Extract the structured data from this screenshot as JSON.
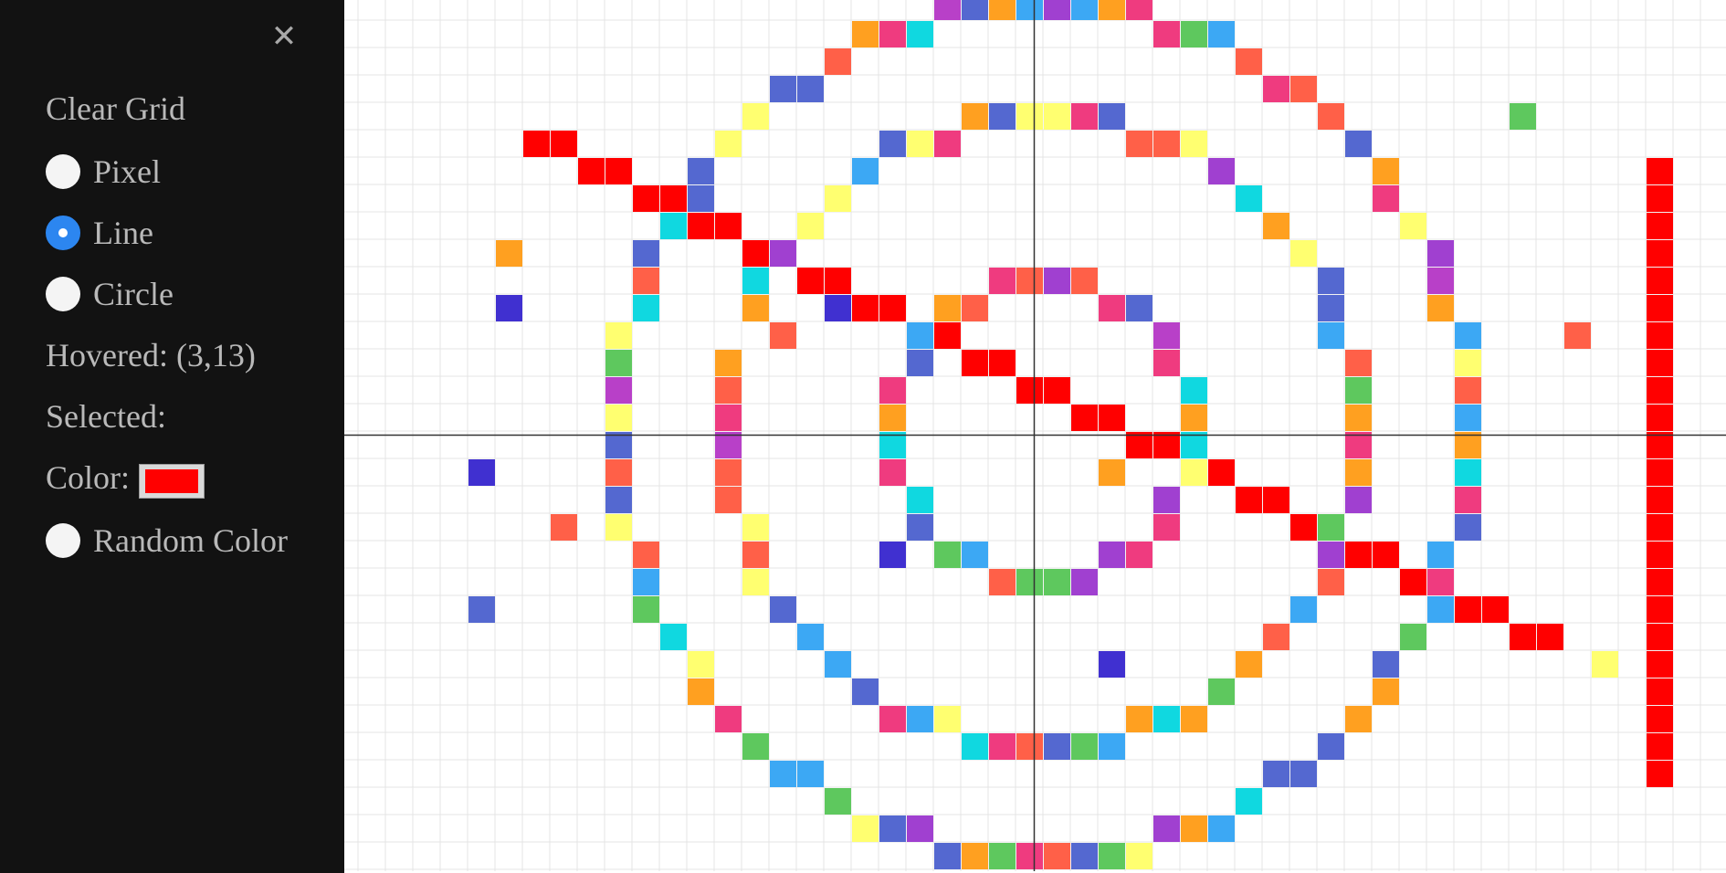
{
  "sidebar": {
    "clear_label": "Clear Grid",
    "modes": [
      {
        "label": "Pixel",
        "checked": false
      },
      {
        "label": "Line",
        "checked": true
      },
      {
        "label": "Circle",
        "checked": false
      }
    ],
    "hovered_text": "Hovered: (3,13)",
    "selected_text": "Selected:",
    "color_label": "Color:",
    "color_value": "#ff0000",
    "random_label": "Random Color",
    "close_icon": "close-icon"
  },
  "grid": {
    "colors": {
      "R": "#ff0000",
      "P": "#ef3b7f",
      "O": "#ff6048",
      "A": "#ffa020",
      "Y": "#ffff70",
      "G": "#5ec85e",
      "C": "#10d8e0",
      "S": "#3ca8f4",
      "B": "#5468d0",
      "V": "#a040d0",
      "I": "#4030d0",
      "M": "#b840c8"
    },
    "cells": [
      {
        "c": "M",
        "x": 21,
        "y": 0
      },
      {
        "c": "B",
        "x": 22,
        "y": 0
      },
      {
        "c": "A",
        "x": 23,
        "y": 0
      },
      {
        "c": "S",
        "x": 24,
        "y": 0
      },
      {
        "c": "V",
        "x": 25,
        "y": 0
      },
      {
        "c": "S",
        "x": 26,
        "y": 0
      },
      {
        "c": "A",
        "x": 27,
        "y": 0
      },
      {
        "c": "P",
        "x": 28,
        "y": 0
      },
      {
        "c": "A",
        "x": 18,
        "y": 1
      },
      {
        "c": "P",
        "x": 19,
        "y": 1
      },
      {
        "c": "C",
        "x": 20,
        "y": 1
      },
      {
        "c": "P",
        "x": 29,
        "y": 1
      },
      {
        "c": "G",
        "x": 30,
        "y": 1
      },
      {
        "c": "S",
        "x": 31,
        "y": 1
      },
      {
        "c": "O",
        "x": 17,
        "y": 2
      },
      {
        "c": "O",
        "x": 32,
        "y": 2
      },
      {
        "c": "B",
        "x": 15,
        "y": 3
      },
      {
        "c": "B",
        "x": 16,
        "y": 3
      },
      {
        "c": "P",
        "x": 33,
        "y": 3
      },
      {
        "c": "O",
        "x": 34,
        "y": 3
      },
      {
        "c": "Y",
        "x": 14,
        "y": 4
      },
      {
        "c": "A",
        "x": 22,
        "y": 4
      },
      {
        "c": "B",
        "x": 23,
        "y": 4
      },
      {
        "c": "Y",
        "x": 24,
        "y": 4
      },
      {
        "c": "Y",
        "x": 25,
        "y": 4
      },
      {
        "c": "P",
        "x": 26,
        "y": 4
      },
      {
        "c": "B",
        "x": 27,
        "y": 4
      },
      {
        "c": "O",
        "x": 35,
        "y": 4
      },
      {
        "c": "G",
        "x": 42,
        "y": 4
      },
      {
        "c": "R",
        "x": 6,
        "y": 5
      },
      {
        "c": "R",
        "x": 7,
        "y": 5
      },
      {
        "c": "Y",
        "x": 13,
        "y": 5
      },
      {
        "c": "B",
        "x": 19,
        "y": 5
      },
      {
        "c": "Y",
        "x": 20,
        "y": 5
      },
      {
        "c": "P",
        "x": 21,
        "y": 5
      },
      {
        "c": "O",
        "x": 28,
        "y": 5
      },
      {
        "c": "O",
        "x": 29,
        "y": 5
      },
      {
        "c": "Y",
        "x": 30,
        "y": 5
      },
      {
        "c": "B",
        "x": 36,
        "y": 5
      },
      {
        "c": "R",
        "x": 8,
        "y": 6
      },
      {
        "c": "R",
        "x": 9,
        "y": 6
      },
      {
        "c": "B",
        "x": 12,
        "y": 6
      },
      {
        "c": "S",
        "x": 18,
        "y": 6
      },
      {
        "c": "V",
        "x": 31,
        "y": 6
      },
      {
        "c": "A",
        "x": 37,
        "y": 6
      },
      {
        "c": "R",
        "x": 47,
        "y": 6
      },
      {
        "c": "R",
        "x": 10,
        "y": 7
      },
      {
        "c": "R",
        "x": 11,
        "y": 7
      },
      {
        "c": "B",
        "x": 12,
        "y": 7
      },
      {
        "c": "Y",
        "x": 17,
        "y": 7
      },
      {
        "c": "C",
        "x": 32,
        "y": 7
      },
      {
        "c": "P",
        "x": 37,
        "y": 7
      },
      {
        "c": "R",
        "x": 47,
        "y": 7
      },
      {
        "c": "C",
        "x": 11,
        "y": 8
      },
      {
        "c": "R",
        "x": 12,
        "y": 8
      },
      {
        "c": "R",
        "x": 13,
        "y": 8
      },
      {
        "c": "Y",
        "x": 16,
        "y": 8
      },
      {
        "c": "A",
        "x": 33,
        "y": 8
      },
      {
        "c": "Y",
        "x": 38,
        "y": 8
      },
      {
        "c": "R",
        "x": 47,
        "y": 8
      },
      {
        "c": "A",
        "x": 5,
        "y": 9
      },
      {
        "c": "B",
        "x": 10,
        "y": 9
      },
      {
        "c": "R",
        "x": 14,
        "y": 9
      },
      {
        "c": "V",
        "x": 15,
        "y": 9
      },
      {
        "c": "Y",
        "x": 34,
        "y": 9
      },
      {
        "c": "V",
        "x": 39,
        "y": 9
      },
      {
        "c": "R",
        "x": 47,
        "y": 9
      },
      {
        "c": "O",
        "x": 10,
        "y": 10
      },
      {
        "c": "C",
        "x": 14,
        "y": 10
      },
      {
        "c": "R",
        "x": 16,
        "y": 10
      },
      {
        "c": "R",
        "x": 17,
        "y": 10
      },
      {
        "c": "P",
        "x": 23,
        "y": 10
      },
      {
        "c": "O",
        "x": 24,
        "y": 10
      },
      {
        "c": "V",
        "x": 25,
        "y": 10
      },
      {
        "c": "O",
        "x": 26,
        "y": 10
      },
      {
        "c": "B",
        "x": 35,
        "y": 10
      },
      {
        "c": "M",
        "x": 39,
        "y": 10
      },
      {
        "c": "R",
        "x": 47,
        "y": 10
      },
      {
        "c": "I",
        "x": 5,
        "y": 11
      },
      {
        "c": "C",
        "x": 10,
        "y": 11
      },
      {
        "c": "A",
        "x": 14,
        "y": 11
      },
      {
        "c": "I",
        "x": 17,
        "y": 11
      },
      {
        "c": "R",
        "x": 18,
        "y": 11
      },
      {
        "c": "R",
        "x": 19,
        "y": 11
      },
      {
        "c": "A",
        "x": 21,
        "y": 11
      },
      {
        "c": "O",
        "x": 22,
        "y": 11
      },
      {
        "c": "P",
        "x": 27,
        "y": 11
      },
      {
        "c": "B",
        "x": 28,
        "y": 11
      },
      {
        "c": "B",
        "x": 35,
        "y": 11
      },
      {
        "c": "A",
        "x": 39,
        "y": 11
      },
      {
        "c": "R",
        "x": 47,
        "y": 11
      },
      {
        "c": "Y",
        "x": 9,
        "y": 12
      },
      {
        "c": "O",
        "x": 15,
        "y": 12
      },
      {
        "c": "S",
        "x": 20,
        "y": 12
      },
      {
        "c": "R",
        "x": 21,
        "y": 12
      },
      {
        "c": "M",
        "x": 29,
        "y": 12
      },
      {
        "c": "S",
        "x": 35,
        "y": 12
      },
      {
        "c": "S",
        "x": 40,
        "y": 12
      },
      {
        "c": "O",
        "x": 44,
        "y": 12
      },
      {
        "c": "R",
        "x": 47,
        "y": 12
      },
      {
        "c": "G",
        "x": 9,
        "y": 13
      },
      {
        "c": "A",
        "x": 13,
        "y": 13
      },
      {
        "c": "B",
        "x": 20,
        "y": 13
      },
      {
        "c": "R",
        "x": 22,
        "y": 13
      },
      {
        "c": "R",
        "x": 23,
        "y": 13
      },
      {
        "c": "P",
        "x": 29,
        "y": 13
      },
      {
        "c": "O",
        "x": 36,
        "y": 13
      },
      {
        "c": "Y",
        "x": 40,
        "y": 13
      },
      {
        "c": "R",
        "x": 47,
        "y": 13
      },
      {
        "c": "M",
        "x": 9,
        "y": 14
      },
      {
        "c": "O",
        "x": 13,
        "y": 14
      },
      {
        "c": "P",
        "x": 19,
        "y": 14
      },
      {
        "c": "R",
        "x": 24,
        "y": 14
      },
      {
        "c": "R",
        "x": 25,
        "y": 14
      },
      {
        "c": "C",
        "x": 30,
        "y": 14
      },
      {
        "c": "G",
        "x": 36,
        "y": 14
      },
      {
        "c": "O",
        "x": 40,
        "y": 14
      },
      {
        "c": "R",
        "x": 47,
        "y": 14
      },
      {
        "c": "Y",
        "x": 9,
        "y": 15
      },
      {
        "c": "P",
        "x": 13,
        "y": 15
      },
      {
        "c": "A",
        "x": 19,
        "y": 15
      },
      {
        "c": "R",
        "x": 26,
        "y": 15
      },
      {
        "c": "R",
        "x": 27,
        "y": 15
      },
      {
        "c": "A",
        "x": 30,
        "y": 15
      },
      {
        "c": "A",
        "x": 36,
        "y": 15
      },
      {
        "c": "S",
        "x": 40,
        "y": 15
      },
      {
        "c": "R",
        "x": 47,
        "y": 15
      },
      {
        "c": "B",
        "x": 9,
        "y": 16
      },
      {
        "c": "M",
        "x": 13,
        "y": 16
      },
      {
        "c": "C",
        "x": 19,
        "y": 16
      },
      {
        "c": "R",
        "x": 28,
        "y": 16
      },
      {
        "c": "R",
        "x": 29,
        "y": 16
      },
      {
        "c": "C",
        "x": 30,
        "y": 16
      },
      {
        "c": "P",
        "x": 36,
        "y": 16
      },
      {
        "c": "A",
        "x": 40,
        "y": 16
      },
      {
        "c": "R",
        "x": 47,
        "y": 16
      },
      {
        "c": "I",
        "x": 4,
        "y": 17
      },
      {
        "c": "O",
        "x": 9,
        "y": 17
      },
      {
        "c": "O",
        "x": 13,
        "y": 17
      },
      {
        "c": "P",
        "x": 19,
        "y": 17
      },
      {
        "c": "A",
        "x": 27,
        "y": 17
      },
      {
        "c": "Y",
        "x": 30,
        "y": 17
      },
      {
        "c": "R",
        "x": 31,
        "y": 17
      },
      {
        "c": "A",
        "x": 36,
        "y": 17
      },
      {
        "c": "C",
        "x": 40,
        "y": 17
      },
      {
        "c": "R",
        "x": 47,
        "y": 17
      },
      {
        "c": "B",
        "x": 9,
        "y": 18
      },
      {
        "c": "O",
        "x": 13,
        "y": 18
      },
      {
        "c": "C",
        "x": 20,
        "y": 18
      },
      {
        "c": "V",
        "x": 29,
        "y": 18
      },
      {
        "c": "R",
        "x": 32,
        "y": 18
      },
      {
        "c": "R",
        "x": 33,
        "y": 18
      },
      {
        "c": "V",
        "x": 36,
        "y": 18
      },
      {
        "c": "P",
        "x": 40,
        "y": 18
      },
      {
        "c": "R",
        "x": 47,
        "y": 18
      },
      {
        "c": "O",
        "x": 7,
        "y": 19
      },
      {
        "c": "Y",
        "x": 9,
        "y": 19
      },
      {
        "c": "Y",
        "x": 14,
        "y": 19
      },
      {
        "c": "B",
        "x": 20,
        "y": 19
      },
      {
        "c": "P",
        "x": 29,
        "y": 19
      },
      {
        "c": "R",
        "x": 34,
        "y": 19
      },
      {
        "c": "G",
        "x": 35,
        "y": 19
      },
      {
        "c": "B",
        "x": 40,
        "y": 19
      },
      {
        "c": "R",
        "x": 47,
        "y": 19
      },
      {
        "c": "O",
        "x": 10,
        "y": 20
      },
      {
        "c": "O",
        "x": 14,
        "y": 20
      },
      {
        "c": "I",
        "x": 19,
        "y": 20
      },
      {
        "c": "G",
        "x": 21,
        "y": 20
      },
      {
        "c": "S",
        "x": 22,
        "y": 20
      },
      {
        "c": "V",
        "x": 27,
        "y": 20
      },
      {
        "c": "P",
        "x": 28,
        "y": 20
      },
      {
        "c": "V",
        "x": 35,
        "y": 20
      },
      {
        "c": "R",
        "x": 36,
        "y": 20
      },
      {
        "c": "R",
        "x": 37,
        "y": 20
      },
      {
        "c": "S",
        "x": 39,
        "y": 20
      },
      {
        "c": "R",
        "x": 47,
        "y": 20
      },
      {
        "c": "S",
        "x": 10,
        "y": 21
      },
      {
        "c": "Y",
        "x": 14,
        "y": 21
      },
      {
        "c": "O",
        "x": 23,
        "y": 21
      },
      {
        "c": "G",
        "x": 24,
        "y": 21
      },
      {
        "c": "G",
        "x": 25,
        "y": 21
      },
      {
        "c": "V",
        "x": 26,
        "y": 21
      },
      {
        "c": "O",
        "x": 35,
        "y": 21
      },
      {
        "c": "R",
        "x": 38,
        "y": 21
      },
      {
        "c": "P",
        "x": 39,
        "y": 21
      },
      {
        "c": "R",
        "x": 47,
        "y": 21
      },
      {
        "c": "B",
        "x": 4,
        "y": 22
      },
      {
        "c": "G",
        "x": 10,
        "y": 22
      },
      {
        "c": "B",
        "x": 15,
        "y": 22
      },
      {
        "c": "S",
        "x": 34,
        "y": 22
      },
      {
        "c": "S",
        "x": 39,
        "y": 22
      },
      {
        "c": "R",
        "x": 40,
        "y": 22
      },
      {
        "c": "R",
        "x": 41,
        "y": 22
      },
      {
        "c": "R",
        "x": 47,
        "y": 22
      },
      {
        "c": "C",
        "x": 11,
        "y": 23
      },
      {
        "c": "S",
        "x": 16,
        "y": 23
      },
      {
        "c": "O",
        "x": 33,
        "y": 23
      },
      {
        "c": "G",
        "x": 38,
        "y": 23
      },
      {
        "c": "R",
        "x": 42,
        "y": 23
      },
      {
        "c": "R",
        "x": 43,
        "y": 23
      },
      {
        "c": "R",
        "x": 47,
        "y": 23
      },
      {
        "c": "Y",
        "x": 12,
        "y": 24
      },
      {
        "c": "S",
        "x": 17,
        "y": 24
      },
      {
        "c": "I",
        "x": 27,
        "y": 24
      },
      {
        "c": "A",
        "x": 32,
        "y": 24
      },
      {
        "c": "B",
        "x": 37,
        "y": 24
      },
      {
        "c": "Y",
        "x": 45,
        "y": 24
      },
      {
        "c": "R",
        "x": 47,
        "y": 24
      },
      {
        "c": "A",
        "x": 12,
        "y": 25
      },
      {
        "c": "B",
        "x": 18,
        "y": 25
      },
      {
        "c": "G",
        "x": 31,
        "y": 25
      },
      {
        "c": "A",
        "x": 37,
        "y": 25
      },
      {
        "c": "R",
        "x": 47,
        "y": 25
      },
      {
        "c": "P",
        "x": 13,
        "y": 26
      },
      {
        "c": "P",
        "x": 19,
        "y": 26
      },
      {
        "c": "S",
        "x": 20,
        "y": 26
      },
      {
        "c": "Y",
        "x": 21,
        "y": 26
      },
      {
        "c": "A",
        "x": 28,
        "y": 26
      },
      {
        "c": "C",
        "x": 29,
        "y": 26
      },
      {
        "c": "A",
        "x": 30,
        "y": 26
      },
      {
        "c": "A",
        "x": 36,
        "y": 26
      },
      {
        "c": "R",
        "x": 47,
        "y": 26
      },
      {
        "c": "G",
        "x": 14,
        "y": 27
      },
      {
        "c": "C",
        "x": 22,
        "y": 27
      },
      {
        "c": "P",
        "x": 23,
        "y": 27
      },
      {
        "c": "O",
        "x": 24,
        "y": 27
      },
      {
        "c": "B",
        "x": 25,
        "y": 27
      },
      {
        "c": "G",
        "x": 26,
        "y": 27
      },
      {
        "c": "S",
        "x": 27,
        "y": 27
      },
      {
        "c": "B",
        "x": 35,
        "y": 27
      },
      {
        "c": "R",
        "x": 47,
        "y": 27
      },
      {
        "c": "S",
        "x": 15,
        "y": 28
      },
      {
        "c": "S",
        "x": 16,
        "y": 28
      },
      {
        "c": "B",
        "x": 33,
        "y": 28
      },
      {
        "c": "B",
        "x": 34,
        "y": 28
      },
      {
        "c": "R",
        "x": 47,
        "y": 28
      },
      {
        "c": "G",
        "x": 17,
        "y": 29
      },
      {
        "c": "C",
        "x": 32,
        "y": 29
      },
      {
        "c": "Y",
        "x": 18,
        "y": 30
      },
      {
        "c": "B",
        "x": 19,
        "y": 30
      },
      {
        "c": "V",
        "x": 20,
        "y": 30
      },
      {
        "c": "V",
        "x": 29,
        "y": 30
      },
      {
        "c": "A",
        "x": 30,
        "y": 30
      },
      {
        "c": "S",
        "x": 31,
        "y": 30
      },
      {
        "c": "B",
        "x": 21,
        "y": 31
      },
      {
        "c": "A",
        "x": 22,
        "y": 31
      },
      {
        "c": "G",
        "x": 23,
        "y": 31
      },
      {
        "c": "P",
        "x": 24,
        "y": 31
      },
      {
        "c": "O",
        "x": 25,
        "y": 31
      },
      {
        "c": "B",
        "x": 26,
        "y": 31
      },
      {
        "c": "G",
        "x": 27,
        "y": 31
      },
      {
        "c": "Y",
        "x": 28,
        "y": 31
      }
    ]
  }
}
